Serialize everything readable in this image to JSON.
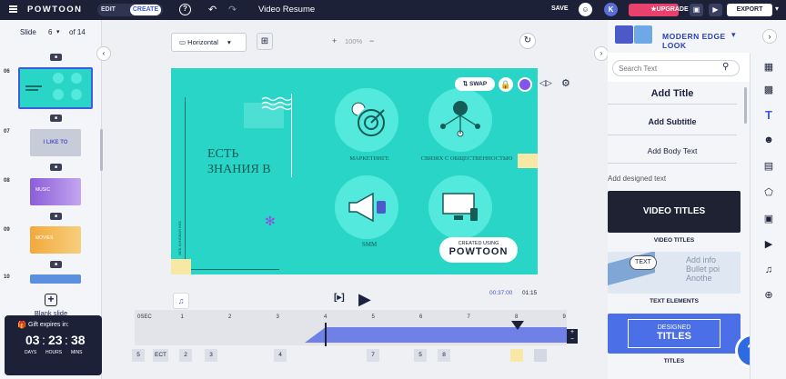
{
  "topbar": {
    "logo": "POWTOON",
    "edit": "EDIT",
    "create": "CREATE",
    "help": "?",
    "title": "Video Resume",
    "save": "SAVE",
    "avatar": "K",
    "upgrade": "UPGRADE",
    "export": "EXPORT"
  },
  "slides": {
    "label": "Slide",
    "current": "6",
    "of": "of 14",
    "items": [
      {
        "num": "06",
        "text": ""
      },
      {
        "num": "07",
        "text": "I LIKE TO"
      },
      {
        "num": "08",
        "text": "MUSIC"
      },
      {
        "num": "09",
        "text": "MOVIES"
      },
      {
        "num": "10",
        "text": ""
      }
    ],
    "blank": "Blank slide"
  },
  "gift": {
    "label": "Gift expires in:",
    "days": "03",
    "hours": "23",
    "mins": "38",
    "days_l": "DAYS",
    "hours_l": "HOURS",
    "mins_l": "MINS"
  },
  "canvas": {
    "orientation": "Horizontal",
    "zoom": "100%",
    "swap": "SWAP",
    "line1": "ЕСТЬ",
    "line2": "ЗНАНИЯ В",
    "vertical_text": "ВЕБ-КИНОВАЯ ВЕБ",
    "icon1": "МАРКЕТИНГЕ",
    "icon2": "СВЯЗЯХ С ОБЩЕСТВЕННОСТЬЮ",
    "icon3": "SMM",
    "badge_small": "CREATED USING",
    "badge_big": "POWTOON",
    "time_cur": "00:37:00",
    "time_end": "01:15"
  },
  "timeline": {
    "ticks": [
      "0SEC",
      "1",
      "2",
      "3",
      "4",
      "5",
      "6",
      "7",
      "8",
      "9"
    ],
    "chips": [
      "5",
      "ECT",
      "2",
      "3",
      "4",
      "7",
      "5",
      "8"
    ]
  },
  "right": {
    "look": "MODERN EDGE LOOK",
    "search_placeholder": "Search Text",
    "title": "Add Title",
    "subtitle": "Add Subtitle",
    "body": "Add Body Text",
    "designed": "Add designed text",
    "cards": [
      {
        "img": "VIDEO TITLES",
        "label": "VIDEO TITLES"
      },
      {
        "img": "TEXT",
        "label": "TEXT ELEMENTS"
      },
      {
        "img1": "DESIGNED",
        "img2": "TITLES",
        "label": "TITLES"
      }
    ],
    "help": "?"
  },
  "colors": {
    "teal": "#29d5c6",
    "accent": "#3b5ddc",
    "dark": "#1c2138",
    "upgrade": "#e8416e"
  }
}
